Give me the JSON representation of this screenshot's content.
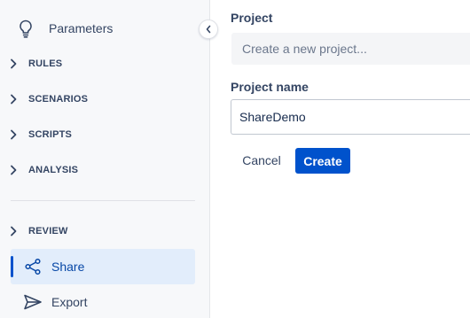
{
  "sidebar": {
    "top_item": {
      "label": "Parameters",
      "icon": "lightbulb-icon"
    },
    "sections": [
      {
        "label": "RULES"
      },
      {
        "label": "SCENARIOS"
      },
      {
        "label": "SCRIPTS"
      },
      {
        "label": "ANALYSIS"
      },
      {
        "label": "REVIEW"
      }
    ],
    "items": [
      {
        "label": "Share",
        "icon": "share-icon",
        "active": true
      },
      {
        "label": "Export",
        "icon": "send-icon",
        "active": false
      }
    ]
  },
  "form": {
    "project": {
      "label": "Project",
      "placeholder": "Create a new project..."
    },
    "project_name": {
      "label": "Project name",
      "value": "ShareDemo"
    },
    "cancel_label": "Cancel",
    "create_label": "Create"
  },
  "colors": {
    "accent": "#0052cc",
    "active_bg": "#e2edfb",
    "sidebar_bg": "#f7f8fa"
  }
}
